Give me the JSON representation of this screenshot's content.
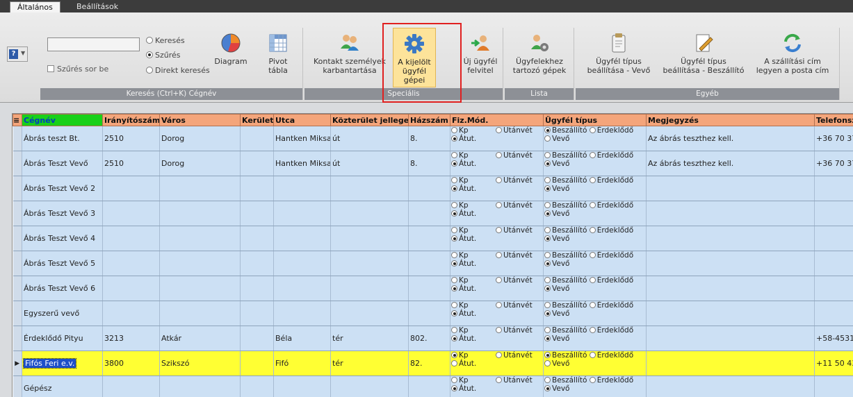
{
  "tabs": [
    {
      "label": "Általános",
      "active": true
    },
    {
      "label": "Beállítások",
      "active": false
    }
  ],
  "ribbon": {
    "search_group": {
      "input_value": "",
      "filter_checkbox_label": "Szűrés sor be",
      "radio_search": "Keresés",
      "radio_filter": "Szűrés",
      "radio_direct": "Direkt keresés",
      "selected": "Szűrés",
      "diagram_label": "Diagram",
      "pivot_label_1": "Pivot",
      "pivot_label_2": "tábla",
      "group_label": "Keresés (Ctrl+K) Cégnév"
    },
    "special_group": {
      "contact_label_1": "Kontakt személyek",
      "contact_label_2": "karbantartása",
      "machines_label_1": "A kijelölt",
      "machines_label_2": "ügyfél gépei",
      "new_label_1": "Új ügyfél",
      "new_label_2": "felvitel",
      "group_label": "Speciális"
    },
    "list_group": {
      "label_1": "Ügyfelekhez",
      "label_2": "tartozó gépek",
      "group_label": "Lista"
    },
    "other_group": {
      "buyer_label_1": "Ügyfél típus",
      "buyer_label_2": "beállítása - Vevő",
      "supplier_label_1": "Ügyfél típus",
      "supplier_label_2": "beállítása - Beszállító",
      "address_label_1": "A szállítási cím",
      "address_label_2": "legyen a posta cím",
      "group_label": "Egyéb"
    },
    "highlight_color": "#e02020"
  },
  "grid": {
    "columns": [
      "Cégnév",
      "Irányítószám",
      "Város",
      "Kerület",
      "Utca",
      "Közterület jellege",
      "Házszám",
      "Fiz.Mód.",
      "Ügyfél típus",
      "Megjegyzés",
      "Telefonsz"
    ],
    "fiz_options": [
      "Kp",
      "Utánvét",
      "Átut."
    ],
    "type_options": [
      "Beszállító",
      "Érdeklődő",
      "Vevő"
    ],
    "rows": [
      {
        "name": "Ábrás teszt Bt.",
        "zip": "2510",
        "city": "Dorog",
        "district": "",
        "street": "Hantken Miksa",
        "street_type": "út",
        "house": "8.",
        "fiz": "Átut.",
        "type": "Beszállító",
        "note": "Az ábrás teszthez kell.",
        "phone": "+36 70 37"
      },
      {
        "name": "Ábrás Teszt Vevő",
        "zip": "2510",
        "city": "Dorog",
        "district": "",
        "street": "Hantken Miksa",
        "street_type": "út",
        "house": "8.",
        "fiz": "Átut.",
        "type": "Vevő",
        "note": "Az ábrás teszthez kell.",
        "phone": "+36 70 37"
      },
      {
        "name": "Ábrás Teszt Vevő 2",
        "zip": "",
        "city": "",
        "district": "",
        "street": "",
        "street_type": "",
        "house": "",
        "fiz": "Átut.",
        "type": "Vevő",
        "note": "",
        "phone": ""
      },
      {
        "name": "Ábrás Teszt Vevő 3",
        "zip": "",
        "city": "",
        "district": "",
        "street": "",
        "street_type": "",
        "house": "",
        "fiz": "Átut.",
        "type": "Vevő",
        "note": "",
        "phone": ""
      },
      {
        "name": "Ábrás Teszt Vevő 4",
        "zip": "",
        "city": "",
        "district": "",
        "street": "",
        "street_type": "",
        "house": "",
        "fiz": "Átut.",
        "type": "Vevő",
        "note": "",
        "phone": ""
      },
      {
        "name": "Ábrás Teszt Vevő 5",
        "zip": "",
        "city": "",
        "district": "",
        "street": "",
        "street_type": "",
        "house": "",
        "fiz": "Átut.",
        "type": "Vevő",
        "note": "",
        "phone": ""
      },
      {
        "name": "Ábrás Teszt Vevő 6",
        "zip": "",
        "city": "",
        "district": "",
        "street": "",
        "street_type": "",
        "house": "",
        "fiz": "Átut.",
        "type": "Vevő",
        "note": "",
        "phone": ""
      },
      {
        "name": "Egyszerű vevő",
        "zip": "",
        "city": "",
        "district": "",
        "street": "",
        "street_type": "",
        "house": "",
        "fiz": "Átut.",
        "type": "Vevő",
        "note": "",
        "phone": ""
      },
      {
        "name": "Érdeklődő Pityu",
        "zip": "3213",
        "city": "Atkár",
        "district": "",
        "street": "Béla",
        "street_type": "tér",
        "house": "802.",
        "fiz": "Átut.",
        "type": "Vevő",
        "note": "",
        "phone": "+58-4531-"
      },
      {
        "name": "Fifós Feri e.v.",
        "zip": "3800",
        "city": "Szikszó",
        "district": "",
        "street": "Fifó",
        "street_type": "tér",
        "house": "82.",
        "fiz": "Kp",
        "type": "Beszállító",
        "note": "",
        "phone": "+11 50 43",
        "selected": true
      },
      {
        "name": "Gépész",
        "zip": "",
        "city": "",
        "district": "",
        "street": "",
        "street_type": "",
        "house": "",
        "fiz": "Átut.",
        "type": "Vevő",
        "note": "",
        "phone": ""
      }
    ]
  }
}
